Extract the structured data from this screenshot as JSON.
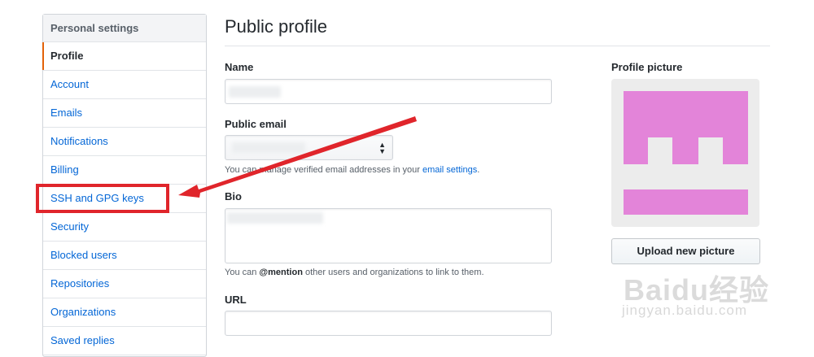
{
  "sidebar": {
    "header": "Personal settings",
    "items": [
      {
        "label": "Profile"
      },
      {
        "label": "Account"
      },
      {
        "label": "Emails"
      },
      {
        "label": "Notifications"
      },
      {
        "label": "Billing"
      },
      {
        "label": "SSH and GPG keys"
      },
      {
        "label": "Security"
      },
      {
        "label": "Blocked users"
      },
      {
        "label": "Repositories"
      },
      {
        "label": "Organizations"
      },
      {
        "label": "Saved replies"
      }
    ]
  },
  "main": {
    "title": "Public profile",
    "name_label": "Name",
    "email_label": "Public email",
    "email_note_prefix": "You can manage verified email addresses in your",
    "email_note_link": "email settings",
    "email_note_suffix": ".",
    "bio_label": "Bio",
    "bio_note_prefix": "You can",
    "bio_note_mention": "@mention",
    "bio_note_suffix": "other users and organizations to link to them.",
    "url_label": "URL"
  },
  "profile_picture": {
    "label": "Profile picture",
    "upload_button": "Upload new picture",
    "avatar_color": "#e384d9"
  },
  "annotation": {
    "highlight_color": "#e0252b"
  },
  "watermark": {
    "logo": "Baidu经验",
    "url": "jingyan.baidu.com"
  }
}
